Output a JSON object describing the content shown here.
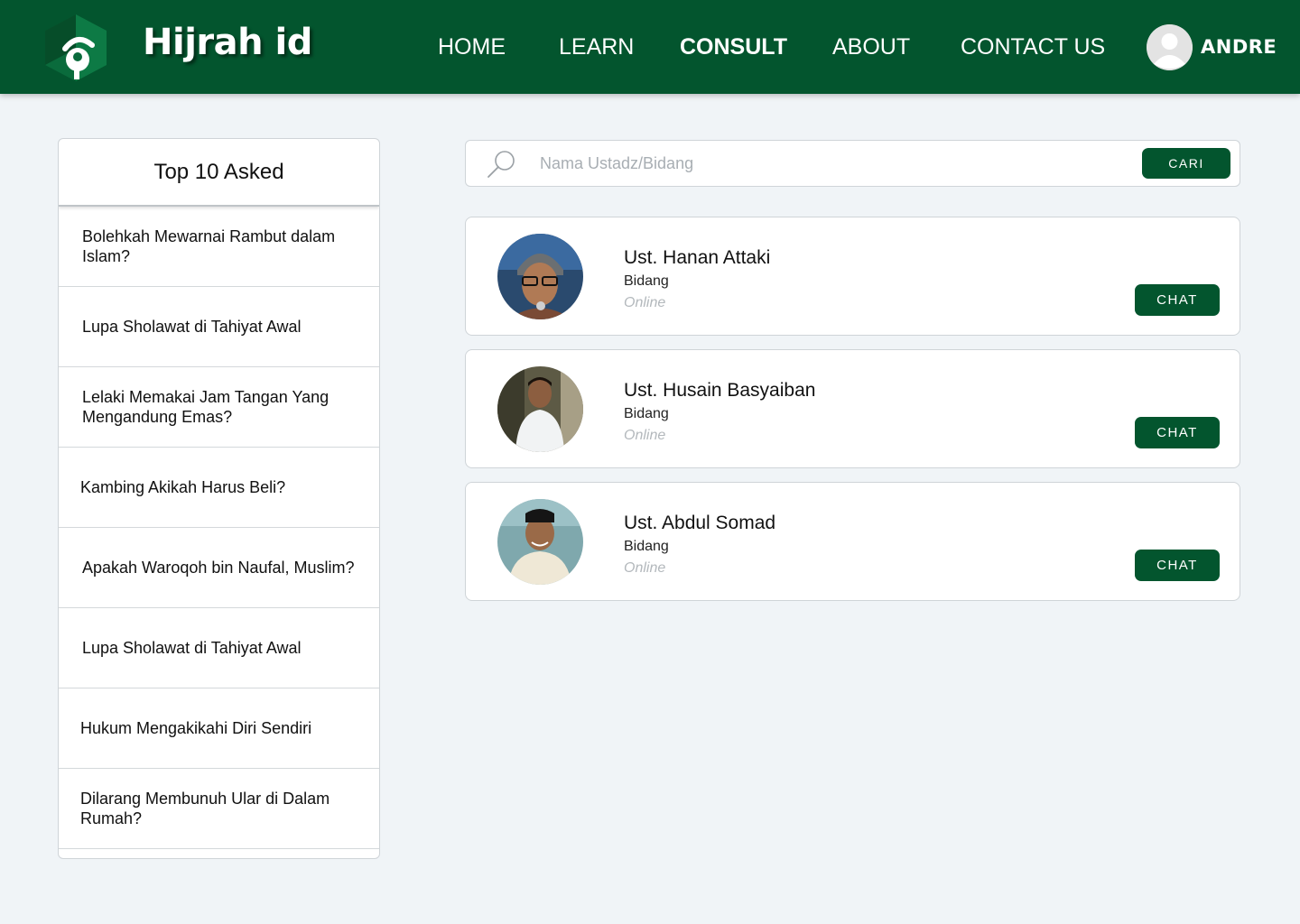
{
  "brand": {
    "name": "Hijrah id"
  },
  "nav": {
    "items": [
      {
        "label": "HOME",
        "active": false
      },
      {
        "label": "LEARN",
        "active": false
      },
      {
        "label": "CONSULT",
        "active": true
      },
      {
        "label": "ABOUT",
        "active": false
      },
      {
        "label": "CONTACT US",
        "active": false
      }
    ],
    "user": {
      "name": "ANDRE",
      "icon": "user-avatar-icon"
    }
  },
  "sidebar": {
    "title": "Top 10 Asked",
    "questions": [
      "Bolehkah Mewarnai Rambut dalam Islam?",
      "Lupa Sholawat di Tahiyat Awal",
      "Lelaki Memakai Jam Tangan Yang Mengandung Emas?",
      "Kambing Akikah Harus Beli?",
      "Apakah Waroqoh bin Naufal, Muslim?",
      "Lupa Sholawat di Tahiyat Awal",
      "Hukum Mengakikahi Diri Sendiri",
      "Dilarang Membunuh Ular di Dalam Rumah?"
    ]
  },
  "search": {
    "placeholder": "Nama Ustadz/Bidang",
    "value": "",
    "button_label": "CARI",
    "icon": "search-icon"
  },
  "consultants": [
    {
      "name": "Ust. Hanan Attaki",
      "field": "Bidang",
      "status": "Online",
      "button_label": "CHAT"
    },
    {
      "name": "Ust. Husain Basyaiban",
      "field": "Bidang",
      "status": "Online",
      "button_label": "CHAT"
    },
    {
      "name": "Ust. Abdul Somad",
      "field": "Bidang",
      "status": "Online",
      "button_label": "CHAT"
    }
  ],
  "colors": {
    "primary": "#03552e",
    "background": "#f0f4f7",
    "status_muted": "#b3b8bc"
  }
}
